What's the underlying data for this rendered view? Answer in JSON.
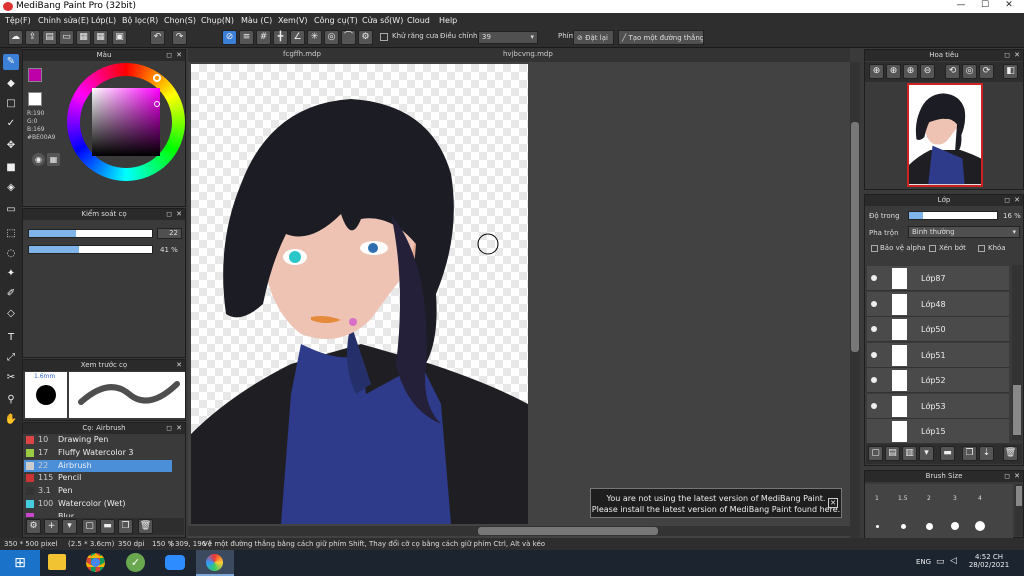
{
  "window": {
    "title": "MediBang Paint Pro (32bit)",
    "minimize": "—",
    "maximize": "☐",
    "close": "✕"
  },
  "menu": [
    "Tệp(F)",
    "Chỉnh sửa(E)",
    "Lớp(L)",
    "Bộ lọc(R)",
    "Chọn(S)",
    "Chụp(N)",
    "Màu (C)",
    "Xem(V)",
    "Công cụ(T)",
    "Cửa sổ(W)",
    "Cloud",
    "Help"
  ],
  "toolbar": {
    "antialias_label": "Khử răng cưa",
    "correction_label": "Điều chỉnh",
    "correction_value": "39",
    "pen_label": "Phím",
    "reset_label": "Đặt lại",
    "straight_line_label": "Tạo một đường thẳng"
  },
  "color_panel": {
    "title": "Màu",
    "r": "R:190",
    "g": "G:0",
    "b": "B:169",
    "hex": "#BE00A9",
    "primary": "#be00a9"
  },
  "brush_control": {
    "title": "Kiểm soát cọ",
    "size_value": "22",
    "size_fill": 0.38,
    "opacity_value": "41 %",
    "opacity_fill": 0.41
  },
  "preview": {
    "title": "Xem trước cọ",
    "size": "1.6mm"
  },
  "brushes": {
    "title": "Cọ: Airbrush",
    "items": [
      {
        "size": "10",
        "name": "Drawing Pen",
        "color": "#d44"
      },
      {
        "size": "17",
        "name": "Fluffy Watercolor 3",
        "color": "#9c4"
      },
      {
        "size": "22",
        "name": "Airbrush",
        "color": "#ccc"
      },
      {
        "size": "115",
        "name": "Pencil",
        "color": "#c33"
      },
      {
        "size": "3.1",
        "name": "Pen",
        "color": "#333"
      },
      {
        "size": "100",
        "name": "Watercolor (Wet)",
        "color": "#4cd"
      },
      {
        "size": "",
        "name": "Blur",
        "color": "#c4c"
      }
    ]
  },
  "tabs": [
    "fcgffh.mdp",
    "hvjbcvng.mdp"
  ],
  "navigator": {
    "title": "Hoa tiêu"
  },
  "layers": {
    "title": "Lớp",
    "opacity_label": "Độ trong",
    "opacity_value": "16 %",
    "opacity_fill": 0.16,
    "blend_label": "Pha trộn",
    "blend_value": "Bình thường",
    "protect_alpha": "Bảo vệ alpha",
    "clipping": "Xén bớt",
    "lock": "Khóa",
    "items": [
      "Lớp87",
      "Lớp48",
      "Lớp50",
      "Lớp51",
      "Lớp52",
      "Lớp53",
      "Lớp15"
    ]
  },
  "brush_size": {
    "title": "Brush Size",
    "row1": [
      "1",
      "1.5",
      "2",
      "3",
      "4"
    ]
  },
  "notice": {
    "line1": "You are not using the latest version of MediBang Paint.",
    "line2": "Please install the latest version of MediBang Paint found here."
  },
  "status": {
    "dims": "350 * 500 pixel",
    "size": "(2.5 * 3.6cm)",
    "dpi": "350 dpi",
    "zoom": "150 %",
    "coords": "( 309, 196 )",
    "hint": "Vẽ một đường thẳng bằng cách giữ phím Shift, Thay đổi cỡ cọ bằng cách giữ phím Ctrl, Alt và kéo"
  },
  "taskbar": {
    "lang": "ENG",
    "time": "4:52 CH",
    "date": "28/02/2021"
  }
}
